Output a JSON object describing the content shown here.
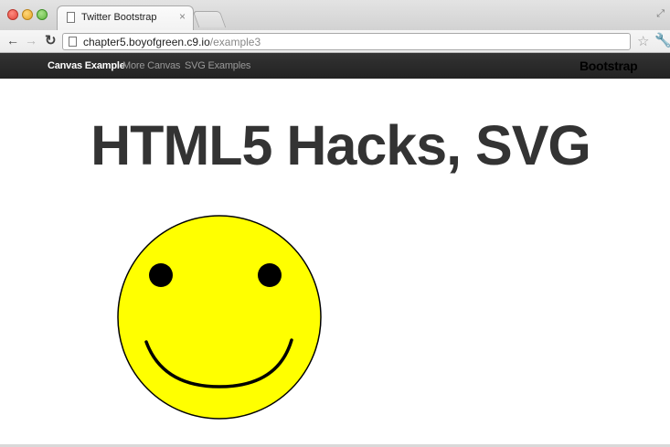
{
  "browser": {
    "tab_title": "Twitter Bootstrap",
    "tab_close": "×",
    "url_host": "chapter5.boyofgreen.c9.io",
    "url_path": "/example3",
    "icons": [
      "page-icon",
      "close-icon",
      "back-icon",
      "forward-icon",
      "reload-icon",
      "star-icon",
      "wrench-icon",
      "resize-icon"
    ]
  },
  "navbar": {
    "items": [
      {
        "label": "Canvas Example",
        "active": true
      },
      {
        "label": "More Canvas",
        "active": false
      },
      {
        "label": "SVG Examples",
        "active": false
      }
    ],
    "brand": "Bootstrap"
  },
  "main": {
    "title": "HTML5 Hacks, SVG"
  },
  "smiley": {
    "face_color": "#ffff00",
    "stroke_color": "#000000"
  },
  "colors": {
    "navbar_bg": "#222222",
    "nav_active": "#ffffff",
    "nav_inactive": "#999999",
    "title": "#333333"
  }
}
